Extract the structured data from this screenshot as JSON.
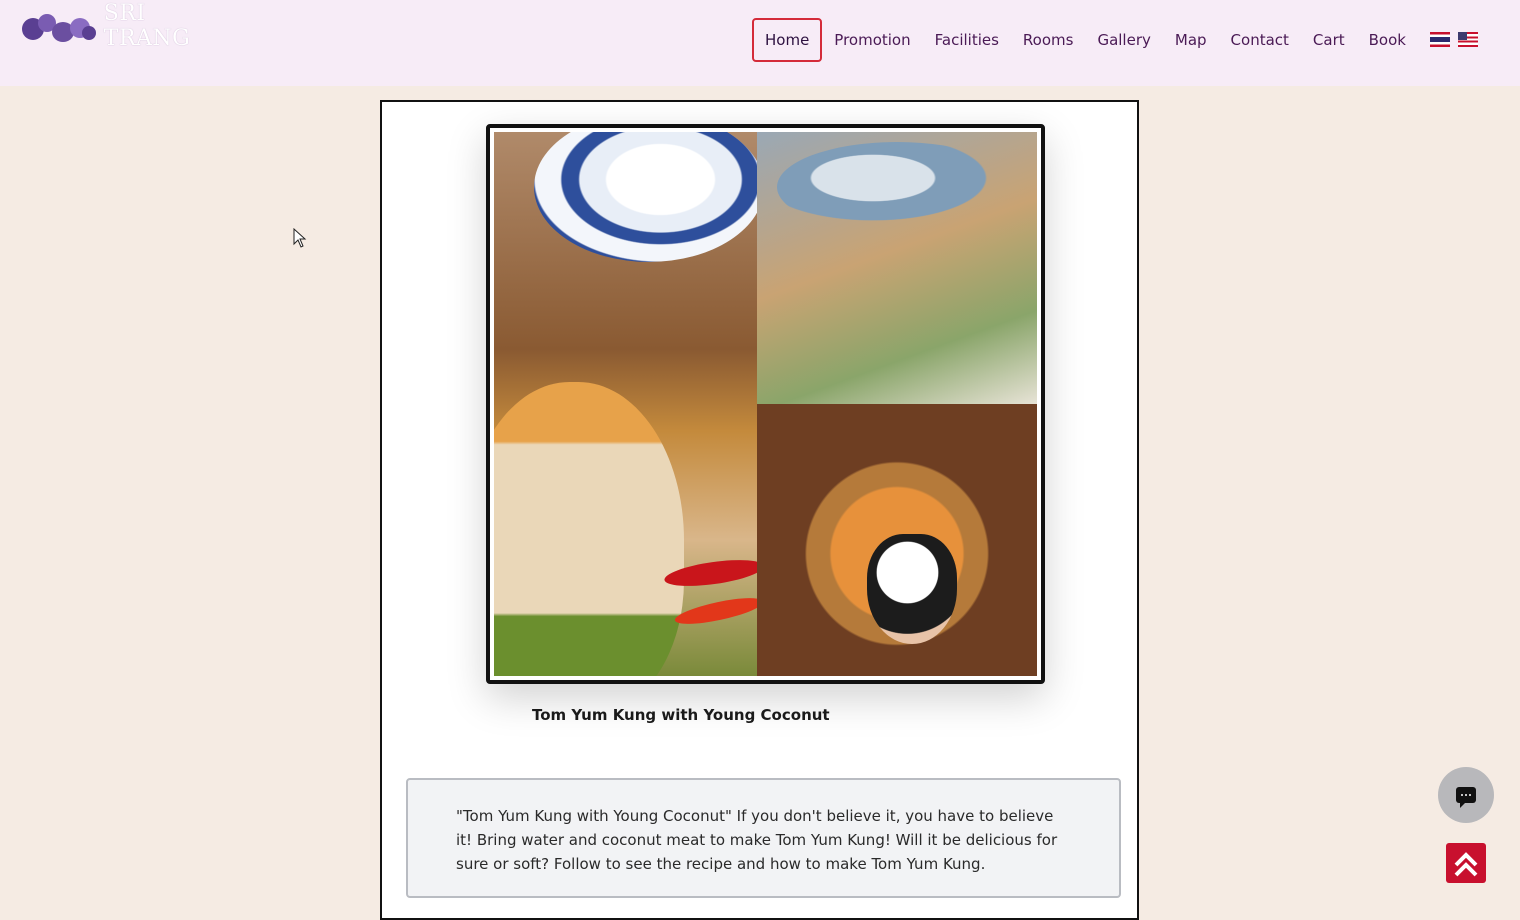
{
  "header": {
    "logo_text": "SRI TRANG",
    "nav": [
      {
        "label": "Home",
        "active": true
      },
      {
        "label": "Promotion"
      },
      {
        "label": "Facilities"
      },
      {
        "label": "Rooms"
      },
      {
        "label": "Gallery"
      },
      {
        "label": "Map"
      },
      {
        "label": "Contact"
      },
      {
        "label": "Cart"
      },
      {
        "label": "Book"
      }
    ],
    "languages": [
      "thai-flag-icon",
      "us-flag-icon"
    ]
  },
  "content": {
    "caption": "Tom Yum Kung with Young Coconut",
    "description": "\"Tom Yum Kung with Young Coconut\" If you don't believe it, you have to believe it! Bring water and coconut meat to make Tom Yum Kung! Will it be delicious for sure or soft? Follow to see the recipe and how to make Tom Yum Kung."
  },
  "floating": {
    "chat_icon": "chat-icon",
    "scroll_top_icon": "double-chevron-up-icon"
  },
  "colors": {
    "header_bg": "#f7ecf7",
    "page_bg": "#f5ebe3",
    "accent": "#c8102e",
    "nav_text": "#4a1a55"
  }
}
